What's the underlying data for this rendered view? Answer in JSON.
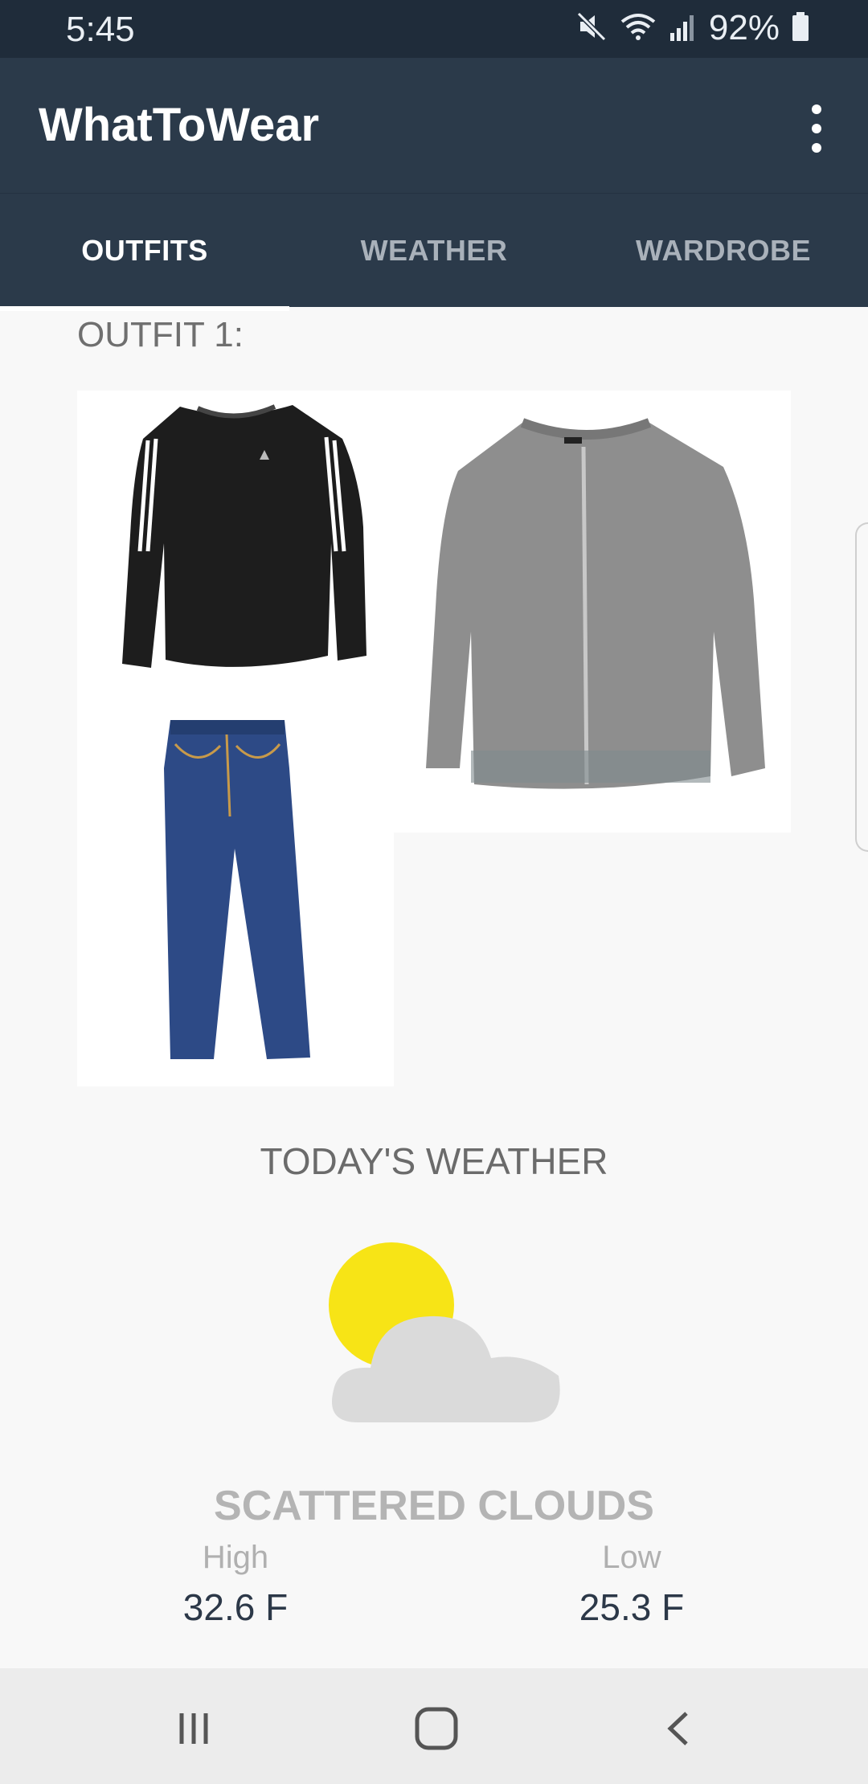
{
  "status_bar": {
    "time": "5:45",
    "battery": "92%",
    "icons": [
      "mute-icon",
      "wifi-icon",
      "signal-icon",
      "battery-icon"
    ]
  },
  "app_bar": {
    "title": "WhatToWear",
    "menu_icon": "more-vert-icon"
  },
  "tabs": [
    {
      "label": "OUTFITS",
      "active": true
    },
    {
      "label": "WEATHER",
      "active": false
    },
    {
      "label": "WARDROBE",
      "active": false
    }
  ],
  "outfit": {
    "label": "OUTFIT 1:",
    "items": [
      "black long-sleeve shirt",
      "grey zip jacket",
      "blue jeans"
    ]
  },
  "weather": {
    "title": "TODAY'S WEATHER",
    "icon": "partly-cloudy-icon",
    "description": "SCATTERED CLOUDS",
    "high_label": "High",
    "high_value": "32.6 F",
    "low_label": "Low",
    "low_value": "25.3 F"
  },
  "nav_bar": {
    "icons": [
      "recent-apps-icon",
      "home-icon",
      "back-icon"
    ]
  },
  "colors": {
    "app_bar": "#2b3a4a",
    "status_bar": "#1f2c3a",
    "sun": "#f7e416",
    "cloud": "#dadada"
  }
}
